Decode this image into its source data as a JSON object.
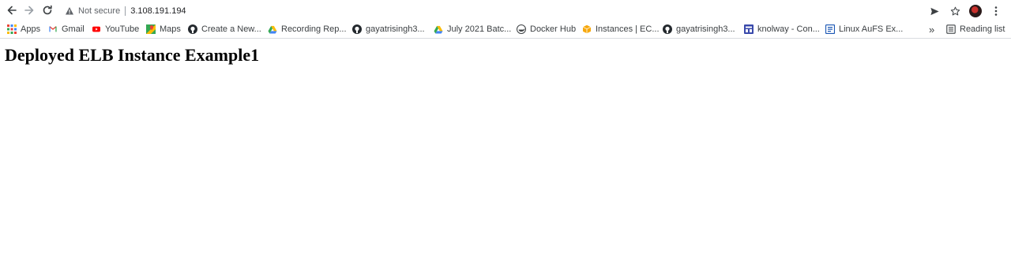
{
  "toolbar": {
    "security_label": "Not secure",
    "url": "3.108.191.194"
  },
  "bookmarks": {
    "items": [
      {
        "label": "Apps",
        "icon": "apps-grid-icon"
      },
      {
        "label": "Gmail",
        "icon": "gmail-icon"
      },
      {
        "label": "YouTube",
        "icon": "youtube-icon"
      },
      {
        "label": "Maps",
        "icon": "maps-icon"
      },
      {
        "label": "Create a New...",
        "icon": "github-icon"
      },
      {
        "label": "Recording Rep...",
        "icon": "google-drive-icon"
      },
      {
        "label": "gayatrisingh3...",
        "icon": "github-icon"
      },
      {
        "label": "July 2021 Batc...",
        "icon": "google-drive-icon"
      },
      {
        "label": "Docker Hub",
        "icon": "docker-icon"
      },
      {
        "label": "Instances | EC...",
        "icon": "aws-cube-icon"
      },
      {
        "label": "gayatrisingh3...",
        "icon": "github-icon"
      },
      {
        "label": "knolway - Con...",
        "icon": "knolway-icon"
      },
      {
        "label": "Linux AuFS Ex...",
        "icon": "document-icon"
      }
    ],
    "overflow": "»",
    "reading_list": "Reading list"
  },
  "page": {
    "heading": "Deployed ELB Instance Example1"
  }
}
